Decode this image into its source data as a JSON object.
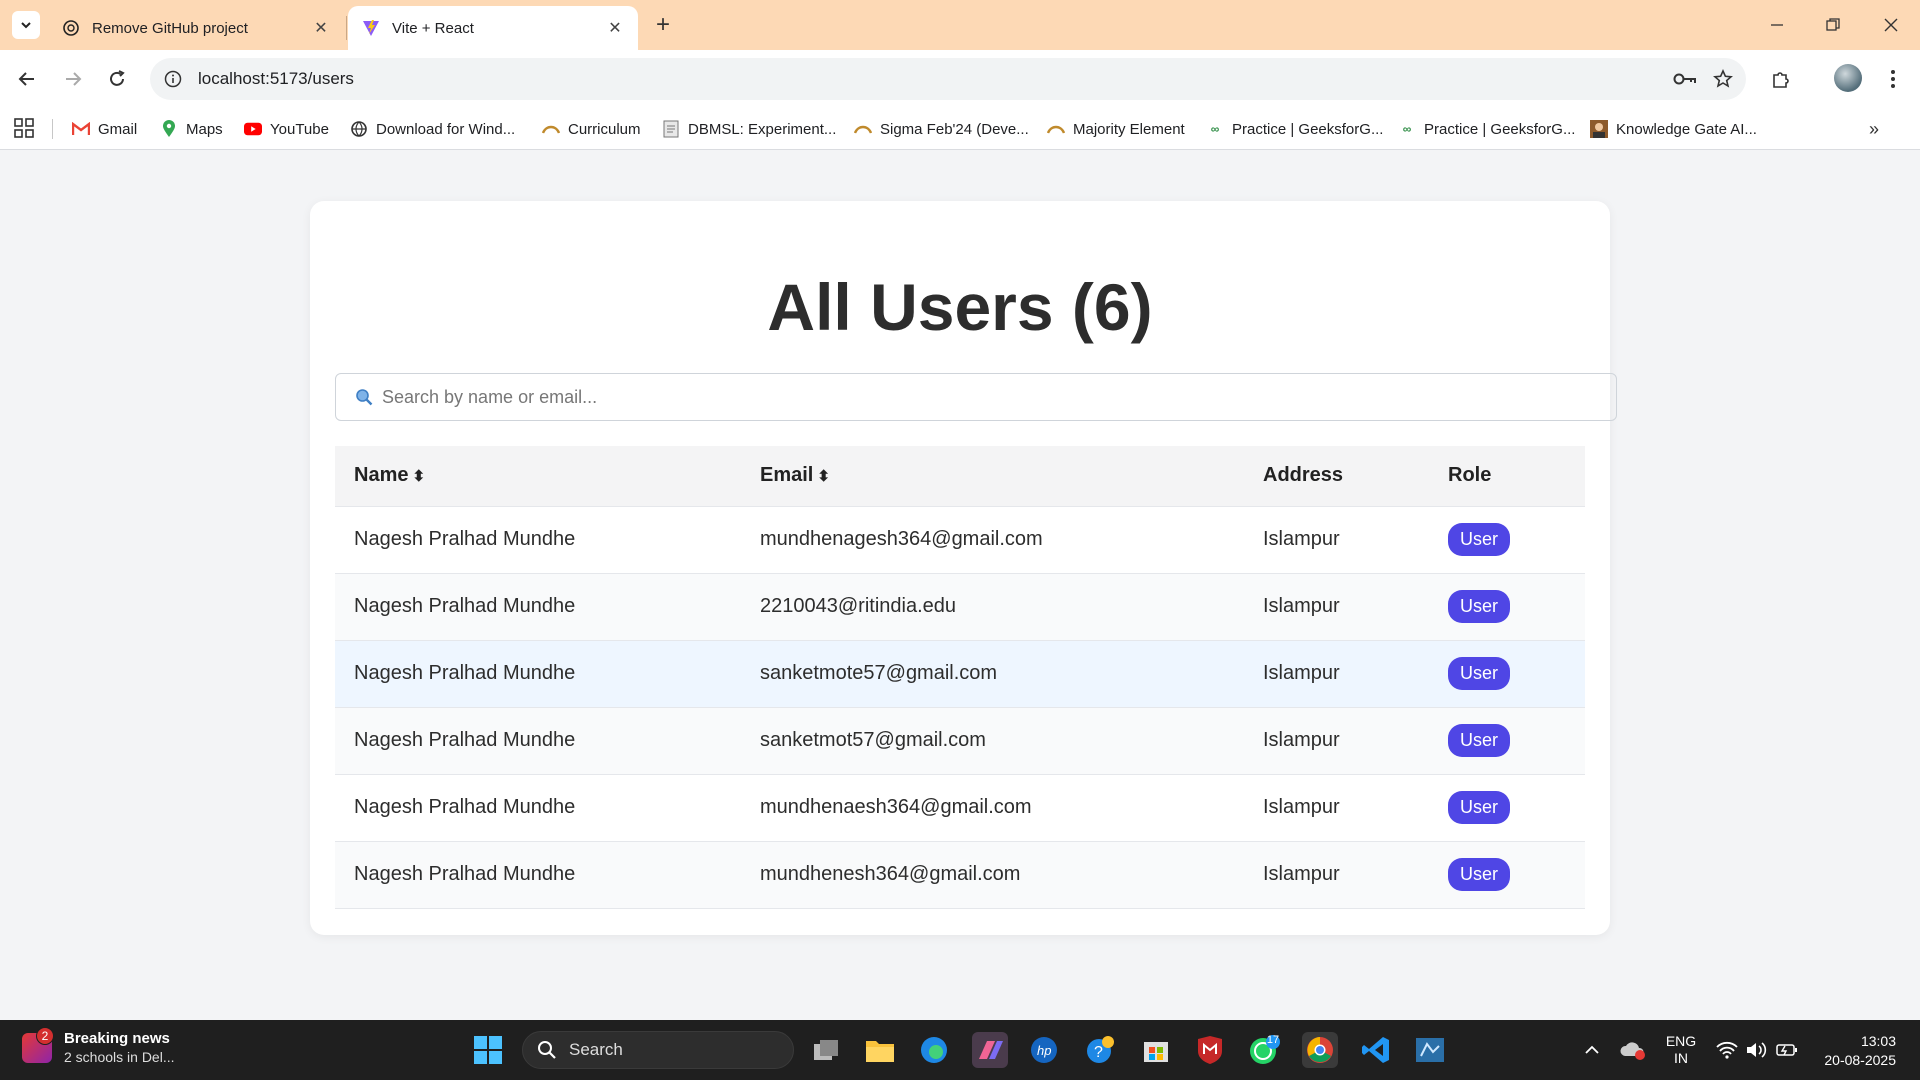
{
  "browser": {
    "tabs": [
      {
        "title": "Remove GitHub project",
        "icon": "chatgpt-icon",
        "active": false
      },
      {
        "title": "Vite + React",
        "icon": "vite-icon",
        "active": true
      }
    ],
    "url": "localhost:5173/users",
    "bookmarks": [
      {
        "label": "Gmail",
        "icon": "gmail-icon"
      },
      {
        "label": "Maps",
        "icon": "maps-icon"
      },
      {
        "label": "YouTube",
        "icon": "youtube-icon"
      },
      {
        "label": "Download for Wind...",
        "icon": "globe-icon"
      },
      {
        "label": "Curriculum",
        "icon": "apna-college-icon"
      },
      {
        "label": "DBMSL: Experiment...",
        "icon": "document-icon"
      },
      {
        "label": "Sigma Feb'24 (Deve...",
        "icon": "apna-college-icon"
      },
      {
        "label": "Majority Element",
        "icon": "apna-college-icon"
      },
      {
        "label": "Practice | GeeksforG...",
        "icon": "gfg-icon"
      },
      {
        "label": "Practice | GeeksforG...",
        "icon": "gfg-icon"
      },
      {
        "label": "Knowledge Gate AI...",
        "icon": "knowledge-gate-icon"
      }
    ]
  },
  "page": {
    "title": "All Users (6)",
    "search_placeholder": "Search by name or email...",
    "columns": {
      "name": "Name",
      "email": "Email",
      "address": "Address",
      "role": "Role",
      "sort_glyph": "⬍"
    },
    "rows": [
      {
        "name": "Nagesh Pralhad Mundhe",
        "email": "mundhenagesh364@gmail.com",
        "address": "Islampur",
        "role": "User"
      },
      {
        "name": "Nagesh Pralhad Mundhe",
        "email": "2210043@ritindia.edu",
        "address": "Islampur",
        "role": "User"
      },
      {
        "name": "Nagesh Pralhad Mundhe",
        "email": "sanketmote57@gmail.com",
        "address": "Islampur",
        "role": "User"
      },
      {
        "name": "Nagesh Pralhad Mundhe",
        "email": "sanketmot57@gmail.com",
        "address": "Islampur",
        "role": "User"
      },
      {
        "name": "Nagesh Pralhad Mundhe",
        "email": "mundhenaesh364@gmail.com",
        "address": "Islampur",
        "role": "User"
      },
      {
        "name": "Nagesh Pralhad Mundhe",
        "email": "mundhenesh364@gmail.com",
        "address": "Islampur",
        "role": "User"
      }
    ],
    "colors": {
      "accent": "#4f46e5",
      "tabstrip": "#fdd9b5",
      "hover_row": "#eef6ff"
    }
  },
  "taskbar": {
    "news_badge": "2",
    "news_title": "Breaking news",
    "news_subtitle": "2 schools in Del...",
    "search_label": "Search",
    "whatsapp_badge": "17",
    "language_line1": "ENG",
    "language_line2": "IN",
    "time": "13:03",
    "date": "20-08-2025"
  }
}
